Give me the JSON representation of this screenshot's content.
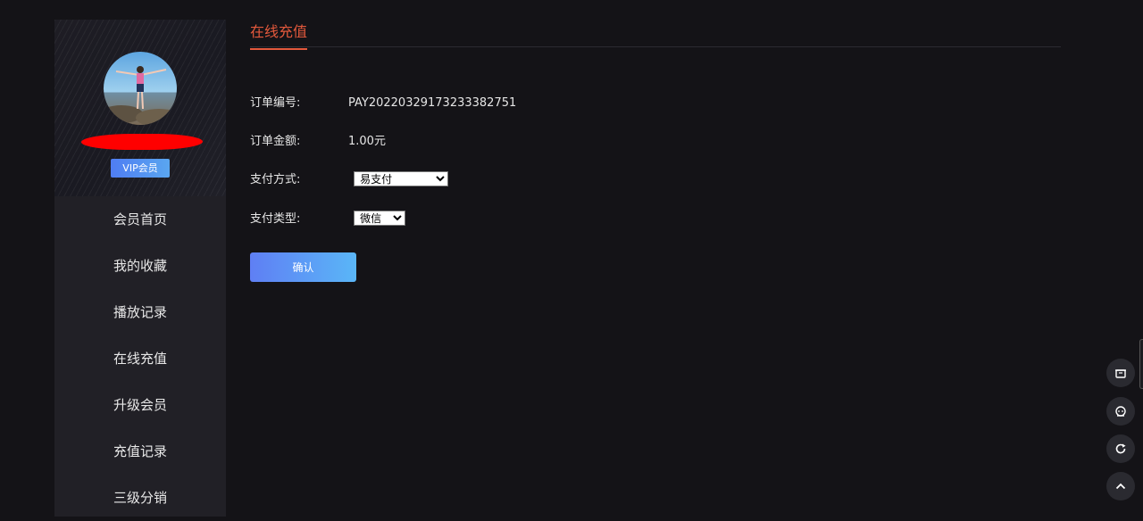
{
  "sidebar": {
    "vip_badge": "VIP会员",
    "menu": [
      {
        "label": "会员首页"
      },
      {
        "label": "我的收藏"
      },
      {
        "label": "播放记录"
      },
      {
        "label": "在线充值"
      },
      {
        "label": "升级会员"
      },
      {
        "label": "充值记录"
      },
      {
        "label": "三级分销"
      }
    ]
  },
  "main": {
    "tab_title": "在线充值",
    "order_no_label": "订单编号:",
    "order_no": "PAY20220329173233382751",
    "amount_label": "订单金额:",
    "amount": "1.00元",
    "pay_method_label": "支付方式:",
    "pay_method_value": "易支付",
    "pay_type_label": "支付类型:",
    "pay_type_value": "微信",
    "confirm_label": "确认"
  },
  "floating_tools": [
    "bag-icon",
    "chat-icon",
    "refresh-icon",
    "arrow-up-icon"
  ],
  "colors": {
    "accent": "#e4593c",
    "button_gradient_start": "#5f7ff4",
    "button_gradient_end": "#5ab6f7",
    "background": "#141317",
    "sidebar": "#212026"
  }
}
